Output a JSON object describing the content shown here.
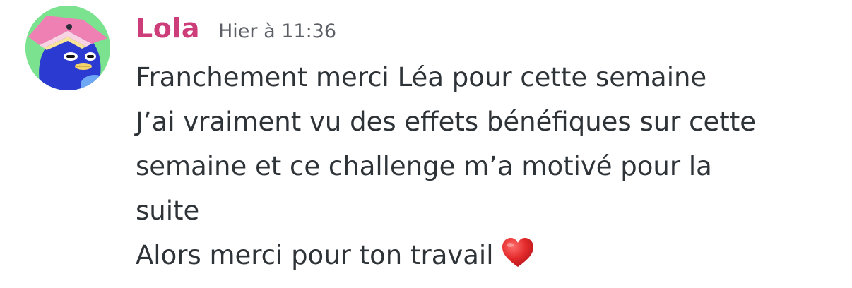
{
  "message": {
    "author": "Lola",
    "timestamp": "Hier à 11:36",
    "lines": [
      "Franchement merci Léa pour cette semaine",
      "J’ai vraiment vu des effets bénéfiques sur cette",
      "semaine et ce challenge m’a motivé pour la",
      "suite",
      "Alors merci pour ton travail"
    ],
    "emoji": "red-heart-icon"
  },
  "colors": {
    "author": "#cc3d7a",
    "timestamp": "#5c5f66",
    "text": "#2e3338",
    "avatar_background": "#7be38f",
    "heart": "#e32b2b"
  },
  "avatar": {
    "icon": "penguin-with-book-avatar"
  }
}
